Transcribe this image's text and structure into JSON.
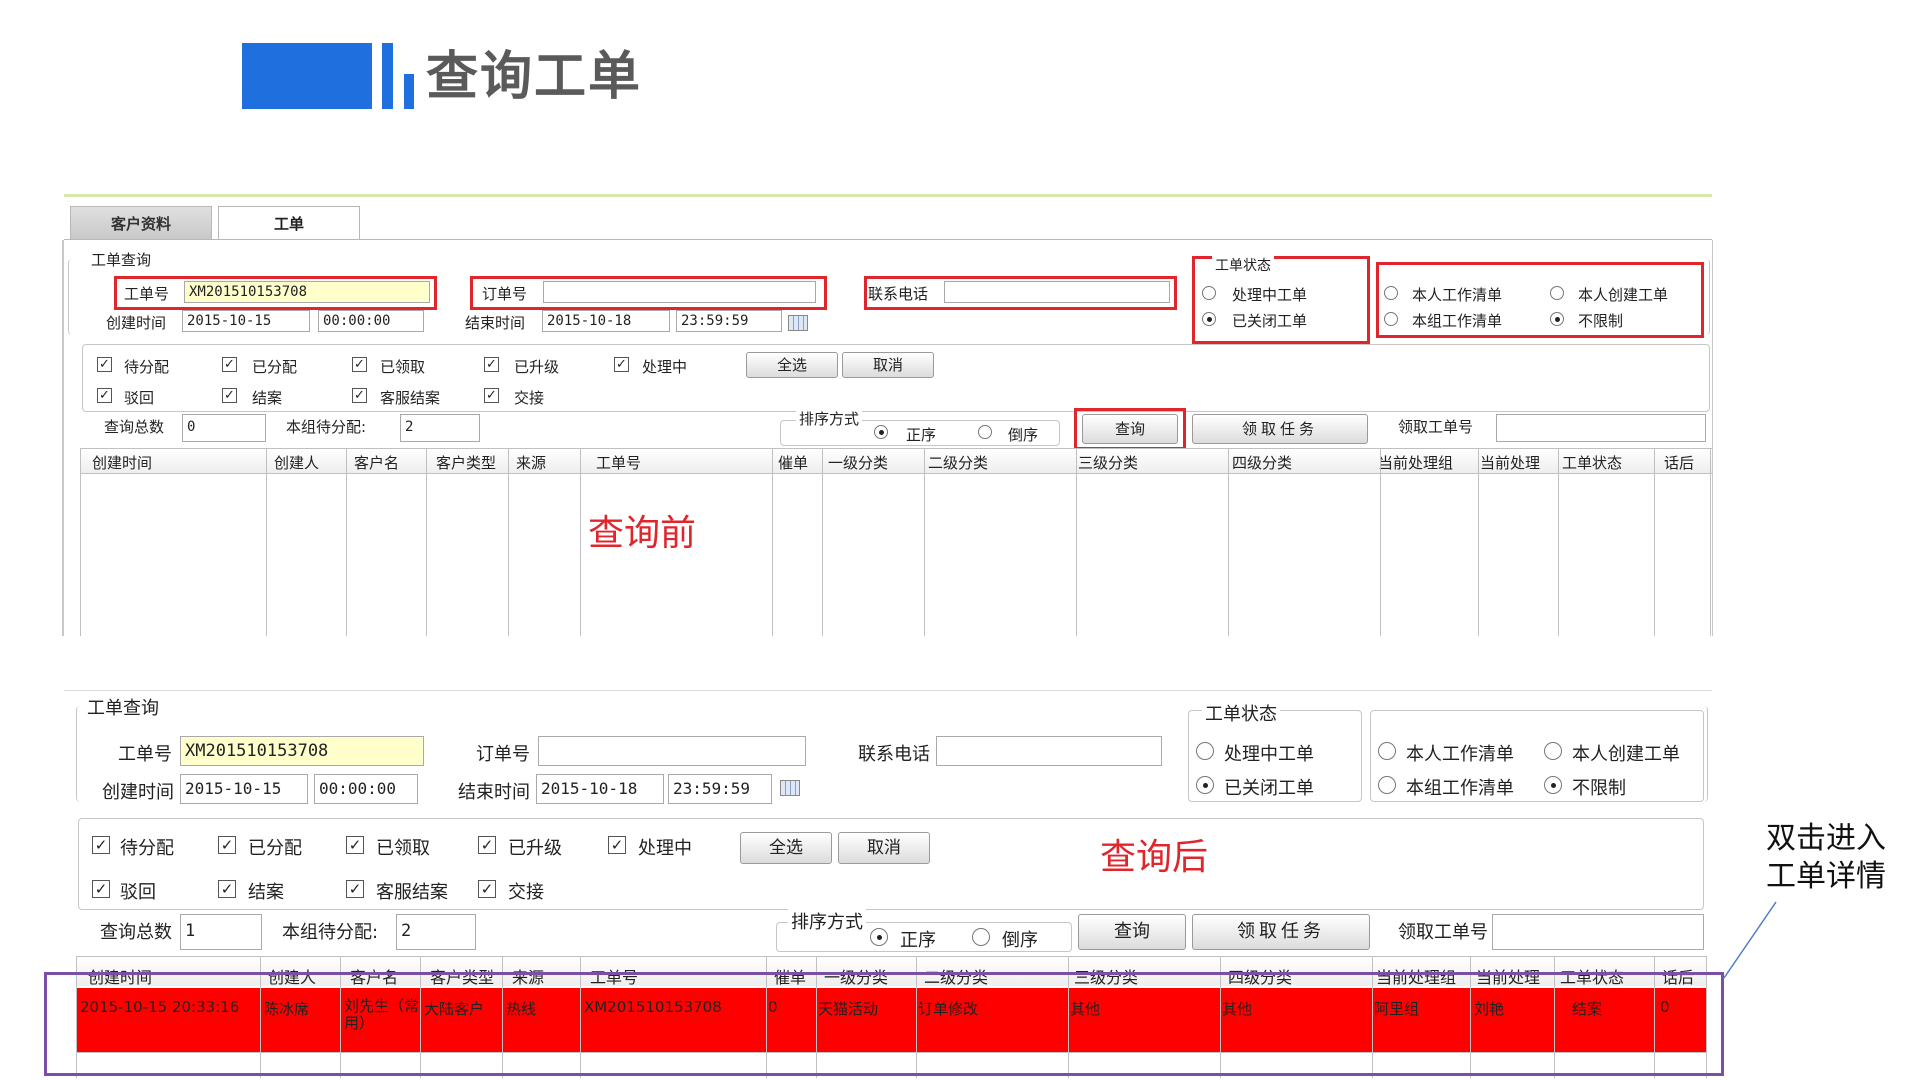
{
  "slide_title": "查询工单",
  "tabs": [
    "客户资料",
    "工单"
  ],
  "before": {
    "legend": "工单查询",
    "order_no_label": "工单号",
    "order_no_value": "XM201510153708",
    "dingdan_label": "订单号",
    "phone_label": "联系电话",
    "created_label": "创建时间",
    "created_date": "2015-10-15",
    "created_time": "00:00:00",
    "end_label": "结束时间",
    "end_date": "2015-10-18",
    "end_time": "23:59:59",
    "status_legend": "工单状态",
    "status_opt1": "处理中工单",
    "status_opt2": "已关闭工单",
    "scope_opt1": "本人工作清单",
    "scope_opt2": "本人创建工单",
    "scope_opt3": "本组工作清单",
    "scope_opt4": "不限制",
    "checks": [
      "待分配",
      "已分配",
      "已领取",
      "已升级",
      "处理中",
      "驳回",
      "结案",
      "客服结案",
      "交接"
    ],
    "select_all": "全选",
    "cancel": "取消",
    "total_label": "查询总数",
    "total_value": "0",
    "pending_label": "本组待分配:",
    "pending_value": "2",
    "sort_label": "排序方式",
    "sort_asc": "正序",
    "sort_desc": "倒序",
    "query_btn": "查询",
    "claim_btn": "领取任务",
    "claim_no_label": "领取工单号",
    "columns": [
      "创建时间",
      "创建人",
      "客户名",
      "客户类型",
      "来源",
      "工单号",
      "催单",
      "一级分类",
      "二级分类",
      "三级分类",
      "四级分类",
      "当前处理组",
      "当前处理",
      "工单状态",
      "话后"
    ],
    "annotation": "查询前"
  },
  "after": {
    "total_value": "1",
    "annotation": "查询后",
    "row": [
      "2015-10-15 20:33:16",
      "陈冰席",
      "刘先生（常用）",
      "大陆客户",
      "热线",
      "XM201510153708",
      "0",
      "天猫活动",
      "订单修改",
      "其他",
      "其他",
      "阿里组",
      "刘艳",
      "结案",
      "0"
    ]
  },
  "side_note": "双击进入工单详情",
  "colors": {
    "brand_blue": "#1f6fde",
    "highlight_red": "#e0262d",
    "row_red": "#ff0000",
    "purple": "#7b4fa6"
  }
}
